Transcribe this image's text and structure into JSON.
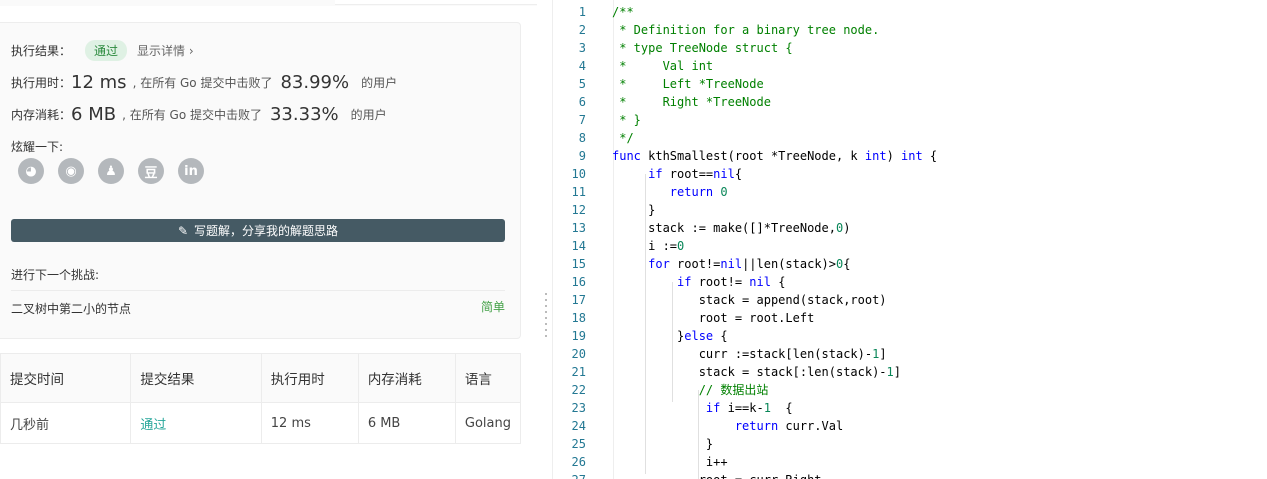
{
  "result": {
    "label": "执行结果：",
    "status": "通过",
    "detail_link": "显示详情 ›",
    "runtime_label": "执行用时：",
    "runtime_value": "12 ms",
    "runtime_middle": ", 在所有 Go 提交中击败了",
    "runtime_percent": "83.99%",
    "runtime_suffix": "的用户",
    "memory_label": "内存消耗：",
    "memory_value": "6 MB",
    "memory_middle": ", 在所有 Go 提交中击败了",
    "memory_percent": "33.33%",
    "memory_suffix": "的用户",
    "share_label": "炫耀一下:",
    "share_icons": [
      "wechat-icon",
      "weibo-icon",
      "qq-icon",
      "douban-icon",
      "linkedin-icon"
    ],
    "share_glyphs": [
      "◕",
      "◉",
      "♟",
      "豆",
      "in"
    ],
    "write_button": "写题解，分享我的解题思路",
    "next_label": "进行下一个挑战:",
    "next_problem": "二叉树中第二小的节点",
    "next_difficulty": "简单"
  },
  "submissions": {
    "headers": [
      "提交时间",
      "提交结果",
      "执行用时",
      "内存消耗",
      "语言"
    ],
    "rows": [
      [
        "几秒前",
        "通过",
        "12 ms",
        "6 MB",
        "Golang"
      ]
    ]
  },
  "colors": {
    "accent_green": "#43a047",
    "button_bg": "#455a64",
    "pass_teal": "#26a69a"
  },
  "editor": {
    "lines": [
      [
        [
          "/**",
          "cm"
        ]
      ],
      [
        [
          " * Definition for a binary tree node.",
          "cm"
        ]
      ],
      [
        [
          " * type TreeNode struct {",
          "cm"
        ]
      ],
      [
        [
          " *     Val int",
          "cm"
        ]
      ],
      [
        [
          " *     Left *TreeNode",
          "cm"
        ]
      ],
      [
        [
          " *     Right *TreeNode",
          "cm"
        ]
      ],
      [
        [
          " * }",
          "cm"
        ]
      ],
      [
        [
          " */",
          "cm"
        ]
      ],
      [
        [
          "func",
          "kw"
        ],
        [
          " kthSmallest(root *TreeNode, k ",
          "pl"
        ],
        [
          "int",
          "kw"
        ],
        [
          ") ",
          "pl"
        ],
        [
          "int",
          "kw"
        ],
        [
          " {",
          "pl"
        ]
      ],
      [
        [
          "     ",
          "pl"
        ],
        [
          "if",
          "kw"
        ],
        [
          " root==",
          "pl"
        ],
        [
          "nil",
          "kw"
        ],
        [
          "{",
          "pl"
        ]
      ],
      [
        [
          "        ",
          "pl"
        ],
        [
          "return",
          "kw"
        ],
        [
          " ",
          "pl"
        ],
        [
          "0",
          "nu"
        ]
      ],
      [
        [
          "     }",
          "pl"
        ]
      ],
      [
        [
          "     stack := make([]*TreeNode,",
          "pl"
        ],
        [
          "0",
          "nu"
        ],
        [
          ")",
          "pl"
        ]
      ],
      [
        [
          "     i :=",
          "pl"
        ],
        [
          "0",
          "nu"
        ]
      ],
      [
        [
          "     ",
          "pl"
        ],
        [
          "for",
          "kw"
        ],
        [
          " root!=",
          "pl"
        ],
        [
          "nil",
          "kw"
        ],
        [
          "||len(stack)>",
          "pl"
        ],
        [
          "0",
          "nu"
        ],
        [
          "{",
          "pl"
        ]
      ],
      [
        [
          "         ",
          "pl"
        ],
        [
          "if",
          "kw"
        ],
        [
          " root!= ",
          "pl"
        ],
        [
          "nil",
          "kw"
        ],
        [
          " {",
          "pl"
        ]
      ],
      [
        [
          "            stack = append(stack,root)",
          "pl"
        ]
      ],
      [
        [
          "            root = root.Left",
          "pl"
        ]
      ],
      [
        [
          "         }",
          "pl"
        ],
        [
          "else",
          "kw"
        ],
        [
          " {",
          "pl"
        ]
      ],
      [
        [
          "            curr :=stack[len(stack)-",
          "pl"
        ],
        [
          "1",
          "nu"
        ],
        [
          "]",
          "pl"
        ]
      ],
      [
        [
          "            stack = stack[:len(stack)-",
          "pl"
        ],
        [
          "1",
          "nu"
        ],
        [
          "]",
          "pl"
        ]
      ],
      [
        [
          "            // 数据出站",
          "cm"
        ]
      ],
      [
        [
          "             ",
          "pl"
        ],
        [
          "if",
          "kw"
        ],
        [
          " i==k-",
          "pl"
        ],
        [
          "1",
          "nu"
        ],
        [
          "  {",
          "pl"
        ]
      ],
      [
        [
          "                 ",
          "pl"
        ],
        [
          "return",
          "kw"
        ],
        [
          " curr.Val",
          "pl"
        ]
      ],
      [
        [
          "             }",
          "pl"
        ]
      ],
      [
        [
          "             i++",
          "pl"
        ]
      ],
      [
        [
          "            root = curr.Right",
          "pl"
        ]
      ]
    ]
  }
}
